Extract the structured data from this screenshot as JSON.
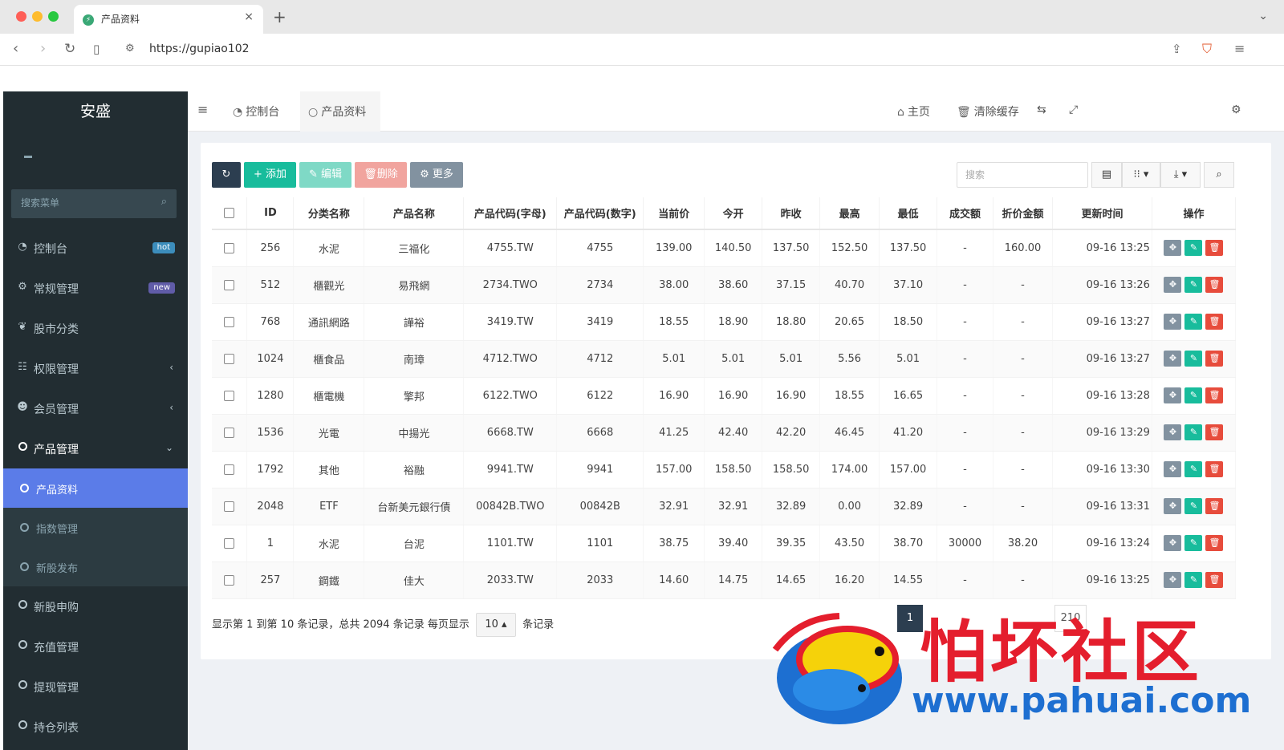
{
  "browser": {
    "tab_title": "产品资料",
    "tab_close": "×",
    "new_tab": "+",
    "url": "https://gupiao102"
  },
  "sidebar": {
    "logo": "安盛",
    "search_placeholder": "搜索菜单",
    "items": [
      {
        "label": "控制台",
        "badge": "hot"
      },
      {
        "label": "常规管理",
        "badge": "new"
      },
      {
        "label": "股市分类"
      },
      {
        "label": "权限管理"
      },
      {
        "label": "会员管理"
      },
      {
        "label": "产品管理"
      }
    ],
    "subitems": [
      {
        "label": "产品资料"
      },
      {
        "label": "指数管理"
      },
      {
        "label": "新股发布"
      }
    ],
    "items_after": [
      {
        "label": "新股申购"
      },
      {
        "label": "充值管理"
      },
      {
        "label": "提现管理"
      },
      {
        "label": "持仓列表"
      }
    ]
  },
  "header": {
    "dashboard": "控制台",
    "current_tab": "产品资料",
    "home": "主页",
    "clear_cache": "清除缓存"
  },
  "toolbar": {
    "add": "添加",
    "edit": "编辑",
    "delete": "删除",
    "more": "更多",
    "search_placeholder": "搜索"
  },
  "table": {
    "columns": [
      "ID",
      "分类名称",
      "产品名称",
      "产品代码(字母)",
      "产品代码(数字)",
      "当前价",
      "今开",
      "昨收",
      "最高",
      "最低",
      "成交额",
      "折价金额",
      "更新时间",
      "操作"
    ],
    "rows": [
      {
        "id": "256",
        "category": "水泥",
        "name": "三福化",
        "code_alpha": "4755.TW",
        "code_num": "4755",
        "price": "139.00",
        "open": "140.50",
        "prev_close": "137.50",
        "high": "152.50",
        "low": "137.50",
        "turnover": "-",
        "discount": "160.00",
        "updated": "09-16 13:25"
      },
      {
        "id": "512",
        "category": "櫃觀光",
        "name": "易飛網",
        "code_alpha": "2734.TWO",
        "code_num": "2734",
        "price": "38.00",
        "open": "38.60",
        "prev_close": "37.15",
        "high": "40.70",
        "low": "37.10",
        "turnover": "-",
        "discount": "-",
        "updated": "09-16 13:26"
      },
      {
        "id": "768",
        "category": "通訊網路",
        "name": "譁裕",
        "code_alpha": "3419.TW",
        "code_num": "3419",
        "price": "18.55",
        "open": "18.90",
        "prev_close": "18.80",
        "high": "20.65",
        "low": "18.50",
        "turnover": "-",
        "discount": "-",
        "updated": "09-16 13:27"
      },
      {
        "id": "1024",
        "category": "櫃食品",
        "name": "南璋",
        "code_alpha": "4712.TWO",
        "code_num": "4712",
        "price": "5.01",
        "open": "5.01",
        "prev_close": "5.01",
        "high": "5.56",
        "low": "5.01",
        "turnover": "-",
        "discount": "-",
        "updated": "09-16 13:27"
      },
      {
        "id": "1280",
        "category": "櫃電機",
        "name": "擎邦",
        "code_alpha": "6122.TWO",
        "code_num": "6122",
        "price": "16.90",
        "open": "16.90",
        "prev_close": "16.90",
        "high": "18.55",
        "low": "16.65",
        "turnover": "-",
        "discount": "-",
        "updated": "09-16 13:28"
      },
      {
        "id": "1536",
        "category": "光電",
        "name": "中揚光",
        "code_alpha": "6668.TW",
        "code_num": "6668",
        "price": "41.25",
        "open": "42.40",
        "prev_close": "42.20",
        "high": "46.45",
        "low": "41.20",
        "turnover": "-",
        "discount": "-",
        "updated": "09-16 13:29"
      },
      {
        "id": "1792",
        "category": "其他",
        "name": "裕融",
        "code_alpha": "9941.TW",
        "code_num": "9941",
        "price": "157.00",
        "open": "158.50",
        "prev_close": "158.50",
        "high": "174.00",
        "low": "157.00",
        "turnover": "-",
        "discount": "-",
        "updated": "09-16 13:30"
      },
      {
        "id": "2048",
        "category": "ETF",
        "name": "台新美元銀行債",
        "code_alpha": "00842B.TWO",
        "code_num": "00842B",
        "price": "32.91",
        "open": "32.91",
        "prev_close": "32.89",
        "high": "0.00",
        "low": "32.89",
        "turnover": "-",
        "discount": "-",
        "updated": "09-16 13:31"
      },
      {
        "id": "1",
        "category": "水泥",
        "name": "台泥",
        "code_alpha": "1101.TW",
        "code_num": "1101",
        "price": "38.75",
        "open": "39.40",
        "prev_close": "39.35",
        "high": "43.50",
        "low": "38.70",
        "turnover": "30000",
        "discount": "38.20",
        "updated": "09-16 13:24"
      },
      {
        "id": "257",
        "category": "鋼鐵",
        "name": "佳大",
        "code_alpha": "2033.TW",
        "code_num": "2033",
        "price": "14.60",
        "open": "14.75",
        "prev_close": "14.65",
        "high": "16.20",
        "low": "14.55",
        "turnover": "-",
        "discount": "-",
        "updated": "09-16 13:25"
      }
    ]
  },
  "footer": {
    "info_prefix": "显示第 1 到第 10 条记录，总共 2094 条记录 每页显示",
    "page_size": "10",
    "info_suffix": "条记录"
  },
  "pagination": {
    "current": "1",
    "last": "210"
  },
  "watermark": {
    "text": "怕坏社区",
    "url": "www.pahuai.com"
  },
  "colors": {
    "sidebar_bg": "#222d32",
    "active_menu": "#5b7ce8",
    "primary": "#2c3e50",
    "success": "#18bc9c",
    "danger": "#e74c3c"
  }
}
